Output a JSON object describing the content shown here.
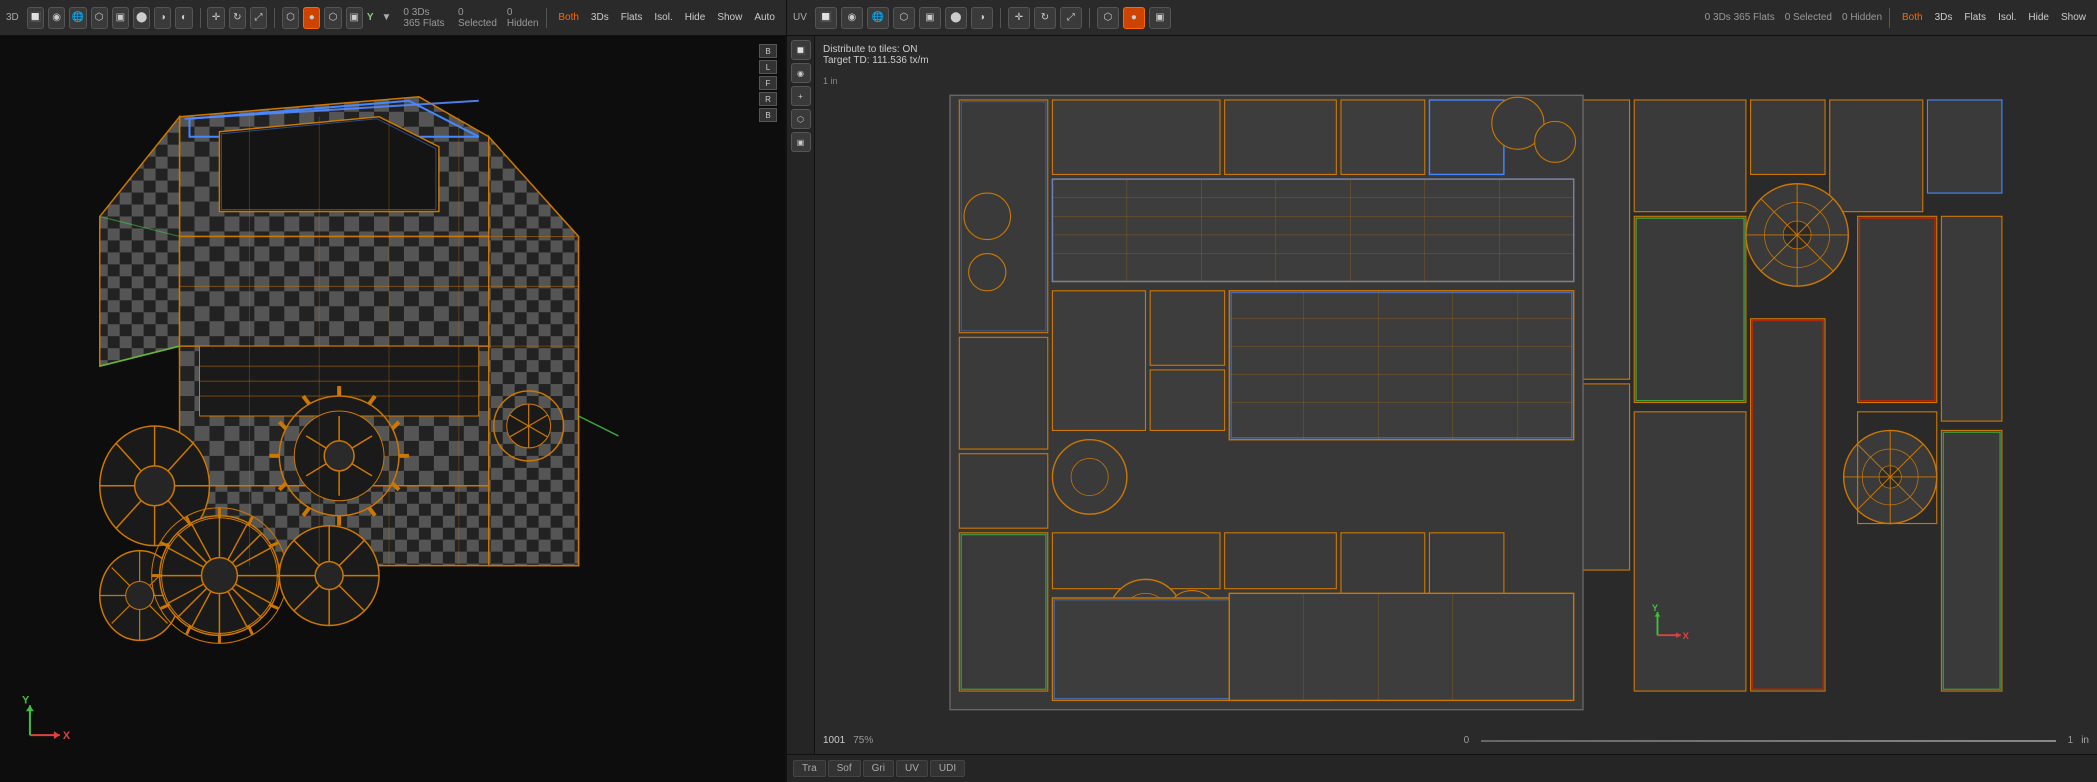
{
  "left_toolbar": {
    "label_3d": "3D",
    "label_shading": "Shading",
    "label_texture": "Texture",
    "label_focus": "Focus",
    "label_opt": "Opt.",
    "label_up": "Up",
    "stats": "0 3Ds 365 Flats",
    "selected": "0 Selected",
    "hidden": "0 Hidden",
    "mode_both": "Both",
    "mode_3ds": "3Ds",
    "mode_flats": "Flats",
    "mode_isol": "Isol.",
    "mode_hide": "Hide",
    "mode_show": "Show",
    "mode_auto": "Auto"
  },
  "right_toolbar": {
    "label_uv": "UV",
    "label_shading": "Shading",
    "label_texture": "Texture",
    "label_focus": "Focus",
    "label_opt": "Opt.",
    "stats": "0 3Ds 365 Flats",
    "selected": "0 Selected",
    "hidden": "0 Hidden",
    "mode_both": "Both",
    "mode_3ds": "3Ds",
    "mode_flats": "Flats",
    "mode_isol": "Isol.",
    "mode_hide": "Hide",
    "mode_show": "Show"
  },
  "uv_info": {
    "distribute": "Distribute to tiles: ON",
    "target_td": "Target TD: 111.536 tx/m"
  },
  "uv_bottom": {
    "tile": "1001",
    "zoom": "75%",
    "range_start": "0",
    "range_end": "1"
  },
  "uv_tabs": [
    {
      "label": "Tra",
      "active": false
    },
    {
      "label": "Sof",
      "active": false
    },
    {
      "label": "Gri",
      "active": false
    },
    {
      "label": "UV",
      "active": false
    },
    {
      "label": "UDI",
      "active": false
    }
  ],
  "overlay_btns": [
    {
      "label": "B"
    },
    {
      "label": "L"
    },
    {
      "label": "F"
    },
    {
      "label": "R"
    },
    {
      "label": "B"
    }
  ],
  "ruler_label": "1 in"
}
